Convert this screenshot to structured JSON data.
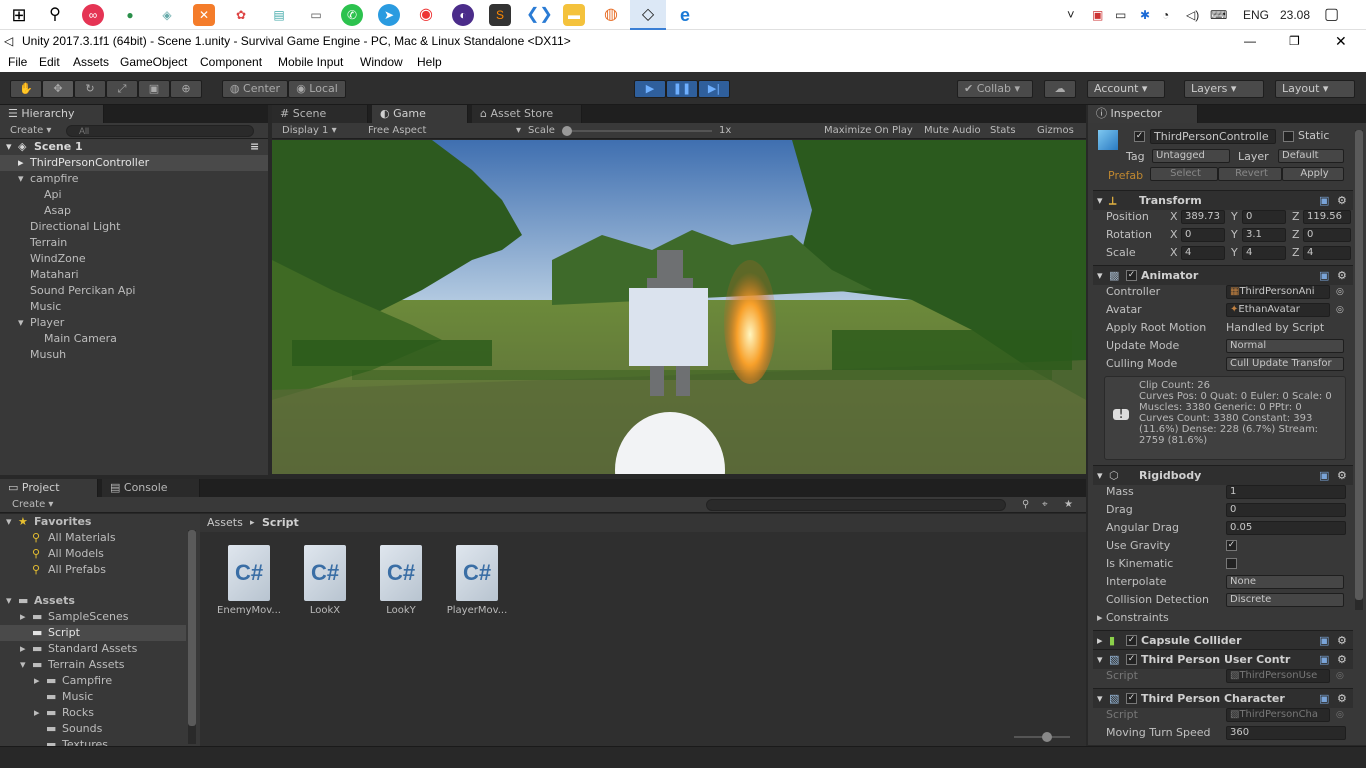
{
  "taskbar": {
    "icons": [
      "windows-start-icon",
      "search-icon",
      "app-icon-1",
      "maps-icon",
      "app-icon-3",
      "xampp-icon",
      "app-icon-5",
      "files-icon",
      "app-icon-7",
      "whatsapp-icon",
      "telegram-icon",
      "chrome-icon",
      "app-icon-12",
      "sublime-icon",
      "vscode-icon",
      "file-explorer-icon",
      "firefox-icon",
      "unity-icon",
      "edge-icon"
    ],
    "language": "ENG",
    "time": "23.08"
  },
  "window": {
    "title": "Unity 2017.3.1f1 (64bit) - Scene 1.unity - Survival Game Engine - PC, Mac & Linux Standalone <DX11>"
  },
  "menu": [
    "File",
    "Edit",
    "Assets",
    "GameObject",
    "Component",
    "Mobile Input",
    "Window",
    "Help"
  ],
  "toolbar": {
    "center_label": "Center",
    "local_label": "Local",
    "collab_label": "Collab",
    "account_label": "Account",
    "layers_label": "Layers",
    "layout_label": "Layout"
  },
  "hierarchy": {
    "tab": "Hierarchy",
    "create_label": "Create",
    "search_placeholder": "All",
    "scene": "Scene 1",
    "items": [
      "ThirdPersonController",
      "campfire",
      "Api",
      "Asap",
      "Directional Light",
      "Terrain",
      "WindZone",
      "Matahari",
      "Sound Percikan Api",
      "Music",
      "Player",
      "Main Camera",
      "Musuh"
    ]
  },
  "game": {
    "tabs": [
      "Scene",
      "Game",
      "Asset Store"
    ],
    "display": "Display 1",
    "aspect": "Free Aspect",
    "scale_label": "Scale",
    "scale_value": "1x",
    "options": [
      "Maximize On Play",
      "Mute Audio",
      "Stats",
      "Gizmos"
    ]
  },
  "project": {
    "tabs": [
      "Project",
      "Console"
    ],
    "create_label": "Create",
    "favorites_label": "Favorites",
    "favorites": [
      "All Materials",
      "All Models",
      "All Prefabs"
    ],
    "assets_label": "Assets",
    "folders": [
      "SampleScenes",
      "Script",
      "Standard Assets",
      "Terrain Assets",
      "Campfire",
      "Music",
      "Rocks",
      "Sounds",
      "Textures"
    ],
    "breadcrumb": [
      "Assets",
      "Script"
    ],
    "files": [
      "EnemyMov...",
      "LookX",
      "LookY",
      "PlayerMov..."
    ],
    "file_icon_text": "C#"
  },
  "inspector": {
    "tab": "Inspector",
    "object_name": "ThirdPersonControlle",
    "static_label": "Static",
    "tag_label": "Tag",
    "tag_value": "Untagged",
    "layer_label": "Layer",
    "layer_value": "Default",
    "prefab_label": "Prefab",
    "prefab_buttons": [
      "Select",
      "Revert",
      "Apply"
    ],
    "transform": {
      "title": "Transform",
      "position_label": "Position",
      "position": [
        "389.73",
        "0",
        "119.56"
      ],
      "rotation_label": "Rotation",
      "rotation": [
        "0",
        "3.1",
        "0"
      ],
      "scale_label": "Scale",
      "scale": [
        "4",
        "4",
        "4"
      ],
      "axes": [
        "X",
        "Y",
        "Z"
      ]
    },
    "animator": {
      "title": "Animator",
      "controller_label": "Controller",
      "controller": "ThirdPersonAni",
      "avatar_label": "Avatar",
      "avatar": "EthanAvatar",
      "root_motion_label": "Apply Root Motion",
      "root_motion": "Handled by Script",
      "update_mode_label": "Update Mode",
      "update_mode": "Normal",
      "culling_label": "Culling Mode",
      "culling": "Cull Update Transfor",
      "info": [
        "Clip Count: 26",
        "Curves Pos: 0 Quat: 0 Euler: 0 Scale: 0",
        "Muscles: 3380 Generic: 0 PPtr: 0",
        "Curves Count: 3380 Constant: 393",
        "(11.6%) Dense: 228 (6.7%) Stream:",
        "2759 (81.6%)"
      ]
    },
    "rigidbody": {
      "title": "Rigidbody",
      "mass_label": "Mass",
      "mass": "1",
      "drag_label": "Drag",
      "drag": "0",
      "angular_drag_label": "Angular Drag",
      "angular_drag": "0.05",
      "gravity_label": "Use Gravity",
      "kinematic_label": "Is Kinematic",
      "interpolate_label": "Interpolate",
      "interpolate": "None",
      "collision_label": "Collision Detection",
      "collision": "Discrete",
      "constraints_label": "Constraints"
    },
    "capsule_title": "Capsule Collider",
    "tpuc": {
      "title": "Third Person User Contr",
      "script_label": "Script",
      "script": "ThirdPersonUse"
    },
    "tpc": {
      "title": "Third Person Character",
      "script_label": "Script",
      "script": "ThirdPersonCha",
      "turn_label": "Moving Turn Speed",
      "turn": "360"
    }
  }
}
